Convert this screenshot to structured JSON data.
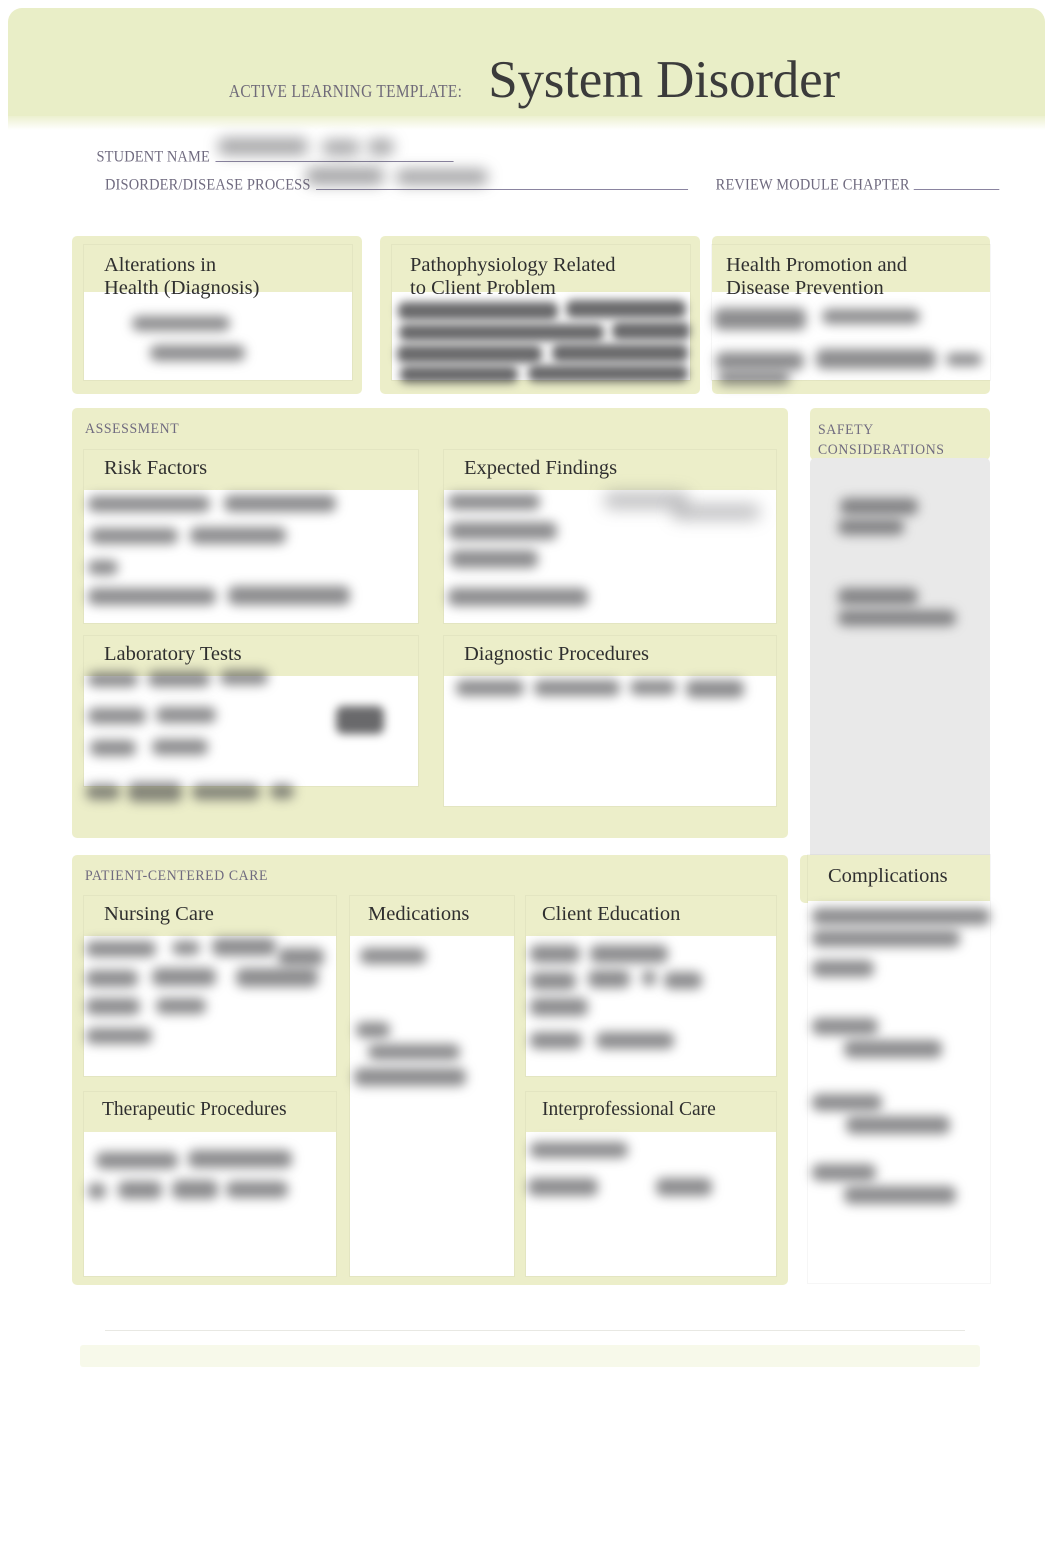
{
  "header": {
    "eyebrow": "ACTIVE LEARNING TEMPLATE:",
    "title": "System Disorder",
    "banner_color": "#e9eec7",
    "title_color": "#3b3b3b",
    "eyebrow_color": "#6f6a79"
  },
  "identification": {
    "student_name_label": "STUDENT NAME",
    "student_name_value": "",
    "disorder_label": "DISORDER/DISEASE PROCESS",
    "disorder_value": "",
    "review_module_label": "REVIEW MODULE CHAPTER",
    "review_module_value": "",
    "label_color": "#6f6a7f"
  },
  "top_row": [
    {
      "id": "alterations",
      "title": "Alterations in\nHealth (Diagnosis)",
      "content": ""
    },
    {
      "id": "pathophysiology",
      "title": "Pathophysiology Related\nto Client Problem",
      "content": ""
    },
    {
      "id": "health-promotion",
      "title": " Health Promotion and\nDisease Prevention",
      "content": ""
    }
  ],
  "assessment": {
    "label": "ASSESSMENT",
    "cards": [
      {
        "id": "risk-factors",
        "title": "Risk Factors",
        "content": ""
      },
      {
        "id": "expected-findings",
        "title": "Expected Findings",
        "content": ""
      },
      {
        "id": "laboratory-tests",
        "title": "Laboratory Tests",
        "content": ""
      },
      {
        "id": "diagnostic-procedures",
        "title": "Diagnostic Procedures",
        "content": ""
      }
    ]
  },
  "safety": {
    "label": "SAFETY\nCONSIDERATIONS",
    "content": ""
  },
  "patient_centered_care": {
    "label": "PATIENT-CENTERED CARE",
    "cards": [
      {
        "id": "nursing-care",
        "title": "Nursing Care",
        "content": ""
      },
      {
        "id": "medications",
        "title": "Medications",
        "content": ""
      },
      {
        "id": "client-education",
        "title": "Client Education",
        "content": ""
      },
      {
        "id": "therapeutic-procedures",
        "title": "Therapeutic Procedures",
        "content": ""
      },
      {
        "id": "interprofessional-care",
        "title": "Interprofessional Care",
        "content": ""
      }
    ]
  },
  "complications": {
    "title": "Complications",
    "content": ""
  },
  "palette": {
    "panel_green": "#eceec9",
    "banner_green": "#e9eec7",
    "grey_body": "#e9e9e9",
    "card_white": "#ffffff",
    "label_purple": "#6f6a7f",
    "heading_black": "#2f2f2f"
  }
}
